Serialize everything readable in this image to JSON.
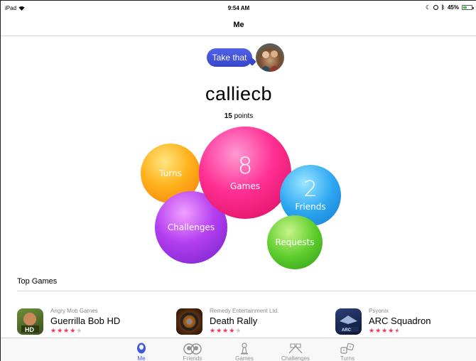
{
  "status": {
    "device": "iPad",
    "time": "9:54 AM",
    "battery": "45%",
    "battery_level": 0.45
  },
  "nav": {
    "title": "Me"
  },
  "profile": {
    "message": "Take that",
    "username": "calliecb",
    "points_value": "15",
    "points_label": "points"
  },
  "bubbles": {
    "turns": {
      "label": "Turns"
    },
    "games": {
      "count": "8",
      "label": "Games"
    },
    "challenges": {
      "label": "Challenges"
    },
    "friends": {
      "count": "2",
      "label": "Friends"
    },
    "requests": {
      "label": "Requests"
    }
  },
  "top_games": {
    "title": "Top Games",
    "items": [
      {
        "developer": "Angry Mob Games",
        "name": "Guerrilla Bob HD",
        "rating": 4,
        "icon": "guerrilla-bob-icon"
      },
      {
        "developer": "Remedy Entertainment Ltd.",
        "name": "Death Rally",
        "rating": 4,
        "icon": "death-rally-icon"
      },
      {
        "developer": "Psyonix",
        "name": "ARC Squadron",
        "rating": 4.5,
        "icon": "arc-squadron-icon"
      }
    ]
  },
  "tabs": [
    {
      "label": "Me",
      "icon": "person-icon",
      "active": true
    },
    {
      "label": "Friends",
      "icon": "friends-icon",
      "active": false
    },
    {
      "label": "Games",
      "icon": "games-icon",
      "active": false
    },
    {
      "label": "Challenges",
      "icon": "challenges-icon",
      "active": false
    },
    {
      "label": "Turns",
      "icon": "turns-icon",
      "active": false
    }
  ],
  "colors": {
    "accent": "#3b5be0",
    "star": "#ff2d55"
  }
}
